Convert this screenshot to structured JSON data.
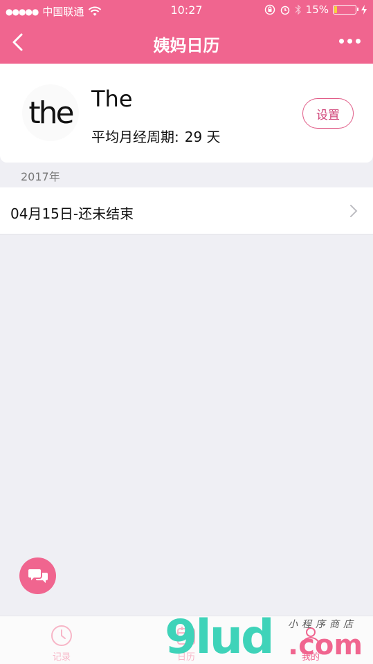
{
  "status_bar": {
    "signal_dots": "●●●●●",
    "carrier": "中国联通",
    "time": "10:27",
    "battery": "15%",
    "battery_level": 0.15,
    "battery_color": "#f6d23a"
  },
  "nav": {
    "title": "姨妈日历"
  },
  "profile": {
    "avatar_text": "the",
    "name": "The",
    "cycle_label": "平均月经周期:",
    "cycle_value": "29 天",
    "settings_label": "设置"
  },
  "records": {
    "year": "2017年",
    "items": [
      {
        "label": "04月15日-还未结束"
      }
    ]
  },
  "tabs": [
    {
      "label": "记录",
      "icon": "clock-icon"
    },
    {
      "label": "日历",
      "icon": "calendar-icon"
    },
    {
      "label": "我的",
      "icon": "user-icon"
    }
  ],
  "watermark": {
    "brand": "9lud",
    "domain": ".com",
    "tagline": "小程序商店"
  },
  "colors": {
    "accent": "#f0658f",
    "background": "#efeff4",
    "tab_inactive": "#f7b6c7"
  }
}
